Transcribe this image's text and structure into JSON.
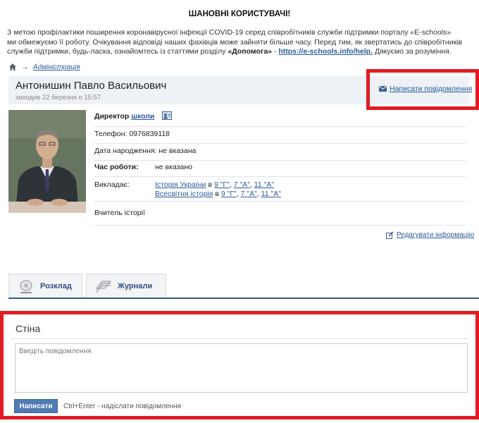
{
  "notice": {
    "title": "ШАНОВНІ КОРИСТУВАЧІ!",
    "line1": "З метою профілактики поширення коронавірусної інфекції COVID-19 серед співробітників служби підтримки порталу «E-schools»",
    "line2": "ми обмежуємо її роботу. Очікування відповіді наших фахівців може зайняти більше часу. Перед тим, як звертатись до співробітників",
    "line3_start": "служби підтримки, будь-ласка, ознайомтесь із статтями розділу ",
    "section": "«Допомога»",
    "dash": " - ",
    "link": "https://e-schools.info/help.",
    "end": " Дякуємо за розуміння."
  },
  "breadcrumb": {
    "arrow": "→",
    "item": "Адміністрація"
  },
  "profile": {
    "name": "Антонишин Павло Васильович",
    "visit": "заходив 22 березня о 15:57",
    "send_message": "Написати повідомлення",
    "role_label": "Директор",
    "role_link": "школи",
    "phone": "Телефон: 0976839118",
    "birthday": "Дата народження: не вказана",
    "hours_label": "Час роботи:",
    "hours_value": "не вказано",
    "teaches_label": "Викладає:",
    "subject1": "Історія України",
    "subject2": "Всесвітня історія",
    "in": " в ",
    "comma": ", ",
    "class1": "9 \"Г\"",
    "class2": "7 \"А\"",
    "class3": "11 \"А\"",
    "position": "Вчитель історії",
    "edit": "Редагувати інформацію"
  },
  "tabs": {
    "schedule": "Розклад",
    "journals": "Журнали"
  },
  "wall": {
    "title": "Стіна",
    "placeholder": "Введіть повідомлення",
    "send": "Написати",
    "hint": "Ctrl+Enter - надіслати повідомлення"
  },
  "colors": {
    "highlight": "#e41b23",
    "link": "#2a5a9a",
    "button": "#4f7ab3"
  }
}
